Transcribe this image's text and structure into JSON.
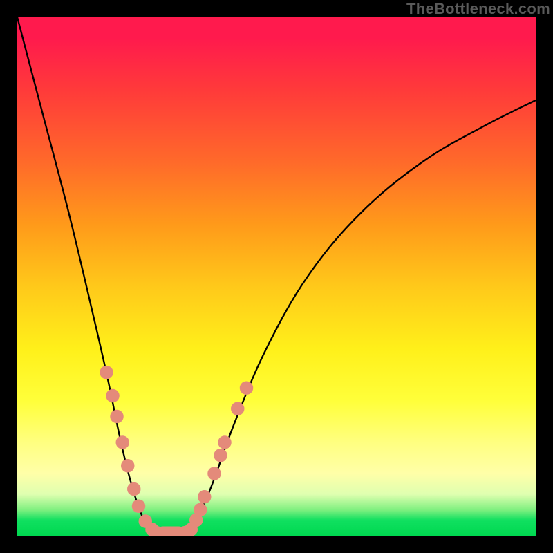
{
  "watermark": "TheBottleneck.com",
  "chart_data": {
    "type": "line",
    "title": "",
    "xlabel": "",
    "ylabel": "",
    "xlim": [
      0,
      100
    ],
    "ylim": [
      0,
      100
    ],
    "grid": false,
    "legend": false,
    "curve_left": {
      "stroke": "#000000",
      "x": [
        0,
        5,
        10,
        15,
        17.5,
        20,
        22,
        24,
        26,
        27
      ],
      "y": [
        100,
        81,
        62,
        41,
        30,
        18,
        10,
        4,
        1,
        0
      ]
    },
    "curve_right": {
      "stroke": "#000000",
      "x": [
        32,
        34,
        36,
        38,
        42,
        48,
        56,
        66,
        78,
        90,
        100
      ],
      "y": [
        0,
        2,
        6,
        11,
        22,
        36,
        50,
        62,
        72,
        79,
        84
      ]
    },
    "dots_left": {
      "fill": "#e48a7a",
      "points": [
        {
          "x": 17.2,
          "y": 31.5
        },
        {
          "x": 18.4,
          "y": 27.0
        },
        {
          "x": 19.2,
          "y": 23.0
        },
        {
          "x": 20.3,
          "y": 18.0
        },
        {
          "x": 21.3,
          "y": 13.5
        },
        {
          "x": 22.5,
          "y": 9.0
        },
        {
          "x": 23.4,
          "y": 5.7
        },
        {
          "x": 24.7,
          "y": 2.8
        },
        {
          "x": 26.0,
          "y": 1.2
        }
      ]
    },
    "dots_right": {
      "fill": "#e48a7a",
      "points": [
        {
          "x": 33.5,
          "y": 1.2
        },
        {
          "x": 34.5,
          "y": 3.0
        },
        {
          "x": 35.3,
          "y": 5.0
        },
        {
          "x": 36.1,
          "y": 7.5
        },
        {
          "x": 38.0,
          "y": 12.0
        },
        {
          "x": 39.2,
          "y": 15.5
        },
        {
          "x": 40.0,
          "y": 18.0
        },
        {
          "x": 42.5,
          "y": 24.5
        },
        {
          "x": 44.2,
          "y": 28.5
        }
      ]
    },
    "valley_blob": {
      "fill": "#e48a7a",
      "x0": 26.8,
      "x1": 32.4,
      "yc": 0.5,
      "ry": 1.3,
      "end_r": 1.4
    },
    "dot_radius": 1.3,
    "colors": {
      "frame": "#000000",
      "gradient_top": "#ff1a4d",
      "gradient_bottom": "#00d850",
      "watermark": "#5a5a5a"
    }
  }
}
